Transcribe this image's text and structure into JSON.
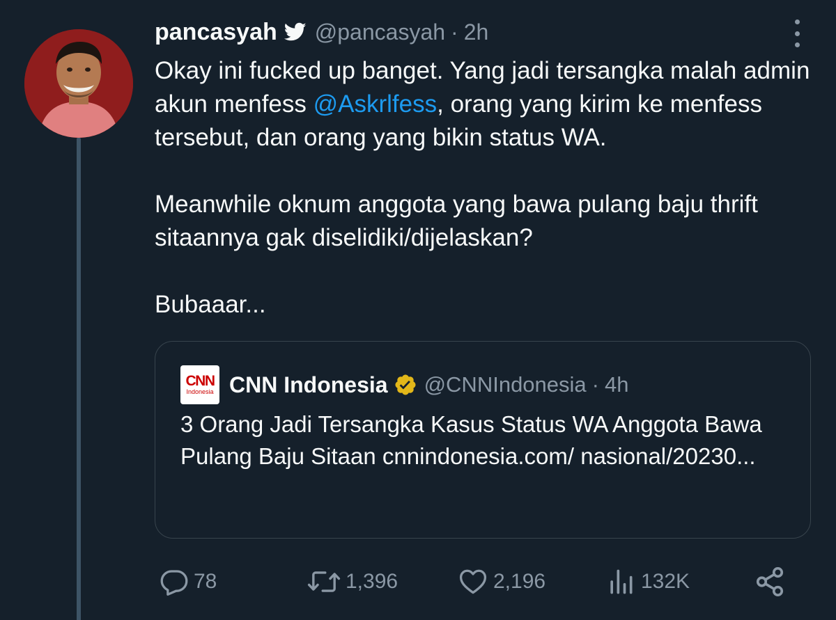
{
  "tweet": {
    "author_name": "pancasyah",
    "author_handle": "@pancasyah",
    "separator": "·",
    "time": "2h",
    "text_line1_a": "Okay ini fucked up banget. Yang jadi tersangka malah admin akun menfess ",
    "mention": "@Askrlfess",
    "text_line1_b": ", orang yang kirim ke menfess tersebut, dan orang yang bikin status WA.",
    "text_para2": "Meanwhile oknum anggota yang bawa pulang baju thrift sitaannya gak diselidiki/dijelaskan?",
    "text_para3": "Bubaaar..."
  },
  "quote": {
    "logo_text": "CNN",
    "logo_subtext": "Indonesia",
    "author_name": "CNN Indonesia",
    "author_handle": "@CNNIndonesia",
    "separator": "·",
    "time": "4h",
    "text": "3 Orang Jadi Tersangka Kasus Status WA Anggota Bawa Pulang Baju Sitaan cnnindonesia.com/ nasional/20230..."
  },
  "actions": {
    "replies": "78",
    "retweets": "1,396",
    "likes": "2,196",
    "views": "132K"
  },
  "icons": {
    "author_badge": "twitter-bird-icon",
    "quote_badge": "verified-gold-badge-icon",
    "reply": "reply-icon",
    "retweet": "retweet-icon",
    "like": "heart-icon",
    "views": "views-chart-icon",
    "share": "share-icon",
    "more": "more-options-icon"
  },
  "colors": {
    "background": "#15202b",
    "text": "#f7f9f9",
    "muted": "#8b98a5",
    "link": "#1d9bf0",
    "gold_badge": "#e2b719",
    "cnn_red": "#cc0000"
  }
}
